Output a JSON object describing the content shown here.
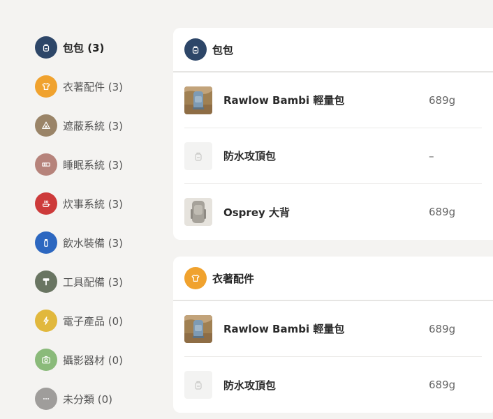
{
  "colors": {
    "bag": "#2d4668",
    "clothing": "#f0a22e",
    "shelter": "#9a8468",
    "sleep": "#b6837b",
    "cooking": "#cd3a3a",
    "water": "#2c67c0",
    "tools": "#697562",
    "electronics": "#e1b83d",
    "photo": "#8aba7a",
    "uncategorized": "#9f9d9b"
  },
  "sidebar": {
    "items": [
      {
        "label": "包包 (3)",
        "icon": "backpack-icon",
        "color": "#2d4668",
        "active": true
      },
      {
        "label": "衣著配件 (3)",
        "icon": "tshirt-icon",
        "color": "#f0a22e"
      },
      {
        "label": "遮蔽系統 (3)",
        "icon": "tent-icon",
        "color": "#9a8468"
      },
      {
        "label": "睡眠系統 (3)",
        "icon": "sleeping-mat-icon",
        "color": "#b6837b"
      },
      {
        "label": "炊事系統 (3)",
        "icon": "stove-icon",
        "color": "#cd3a3a"
      },
      {
        "label": "飲水裝備 (3)",
        "icon": "water-bottle-icon",
        "color": "#2c67c0"
      },
      {
        "label": "工具配備 (3)",
        "icon": "hammer-icon",
        "color": "#697562"
      },
      {
        "label": "電子產品 (0)",
        "icon": "lightning-icon",
        "color": "#e1b83d"
      },
      {
        "label": "攝影器材 (0)",
        "icon": "camera-icon",
        "color": "#8aba7a"
      },
      {
        "label": "未分類 (0)",
        "icon": "more-icon",
        "color": "#9f9d9b"
      }
    ]
  },
  "sections": [
    {
      "title": "包包",
      "icon": "backpack-icon",
      "items": [
        {
          "name": "Rawlow Bambi 輕量包",
          "weight": "689g",
          "thumb": "blue-backpack-photo"
        },
        {
          "name": "防水攻頂包",
          "weight": "–",
          "thumb": "placeholder-backpack-icon"
        },
        {
          "name": "Osprey 大背",
          "weight": "689g",
          "thumb": "gray-backpack-photo"
        }
      ]
    },
    {
      "title": "衣著配件",
      "icon": "tshirt-icon",
      "items": [
        {
          "name": "Rawlow Bambi 輕量包",
          "weight": "689g",
          "thumb": "blue-backpack-photo"
        },
        {
          "name": "防水攻頂包",
          "weight": "689g",
          "thumb": "placeholder-backpack-icon"
        }
      ]
    }
  ]
}
